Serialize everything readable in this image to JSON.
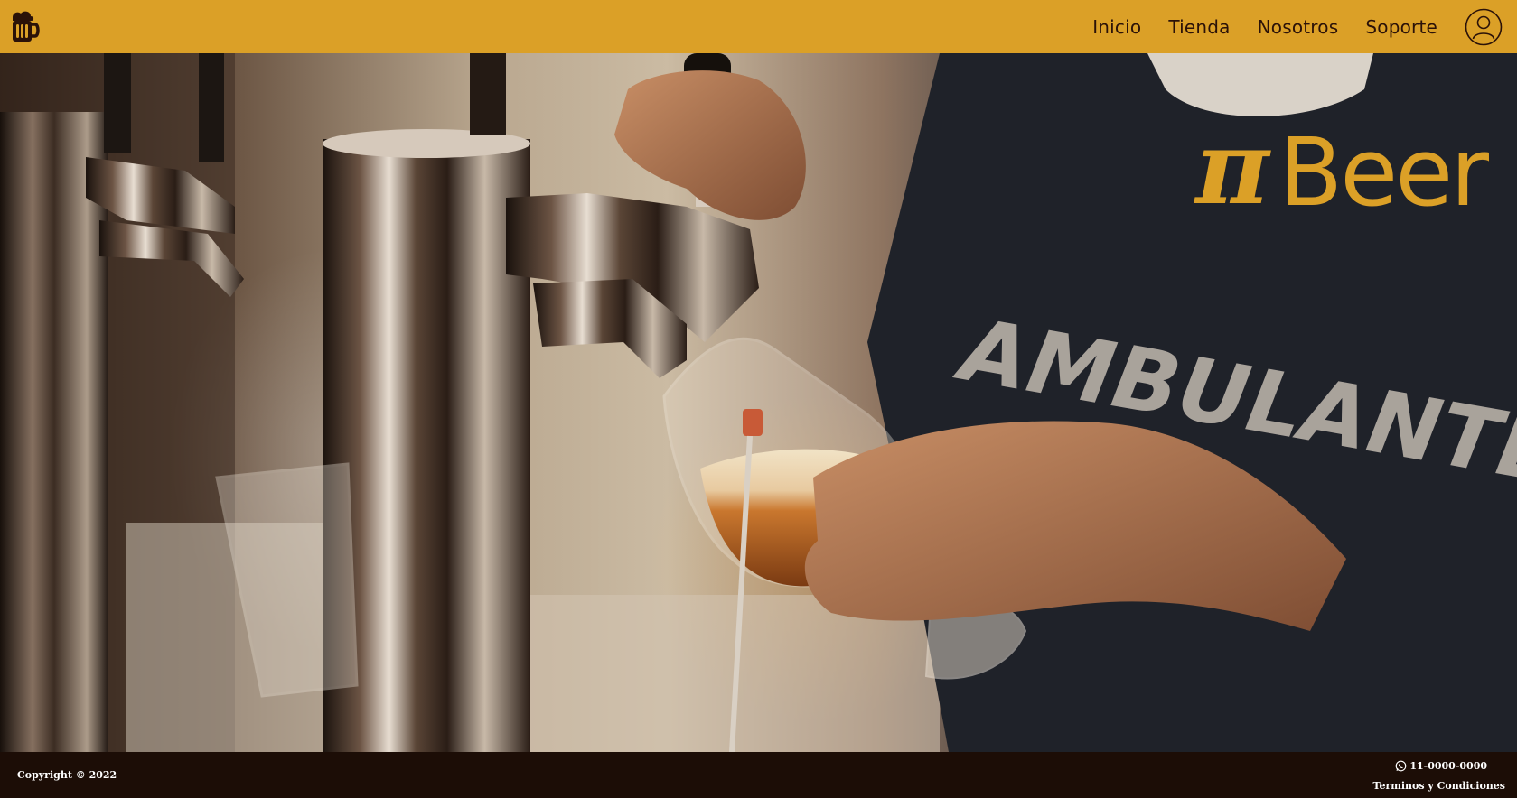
{
  "navbar": {
    "brand_icon": "beer-mug-icon",
    "links": [
      "Inicio",
      "Tienda",
      "Nosotros",
      "Soporte"
    ],
    "user_icon": "user-account-icon",
    "background_color": "#dba027",
    "text_color": "#2b1208"
  },
  "hero": {
    "image": "bartender pouring beer from tap into glass",
    "logo": {
      "symbol": "π",
      "word": "Beer",
      "color": "#dba027"
    }
  },
  "footer": {
    "copyright": "Copyright © 2022",
    "phone_icon": "whatsapp-icon",
    "phone": "11-0000-0000",
    "terms": "Terminos y Condiciones",
    "background_color": "#1c0d06"
  }
}
